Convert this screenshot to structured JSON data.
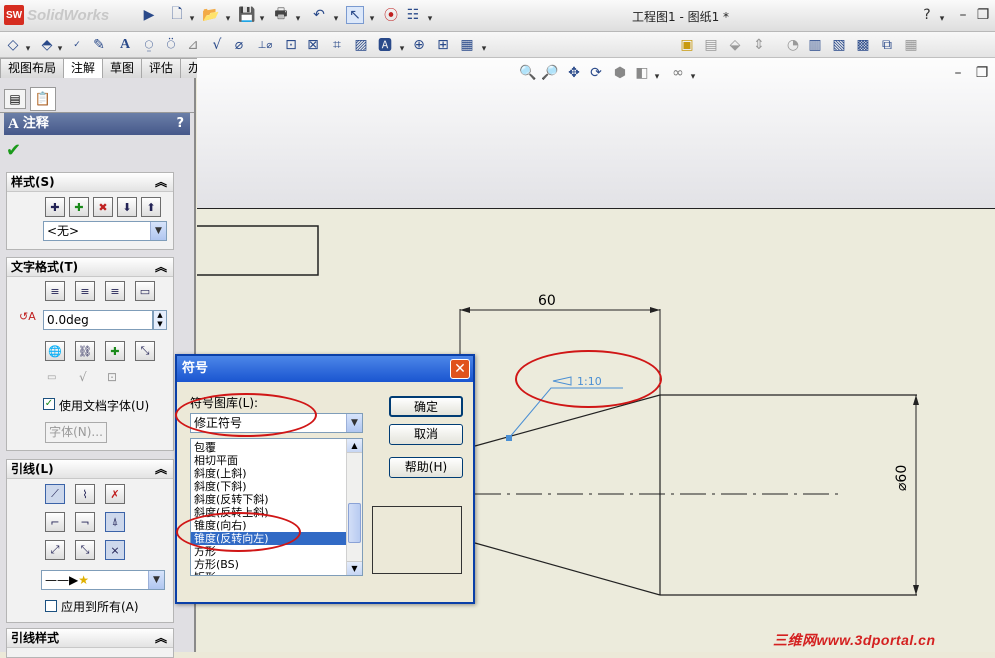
{
  "app": {
    "logo": "SolidWorks",
    "logo_mark": "SW",
    "window_title": "工程图1 - 图纸1 *",
    "help_icon": "?"
  },
  "tabs": [
    {
      "label": "视图布局"
    },
    {
      "label": "注解"
    },
    {
      "label": "草图"
    },
    {
      "label": "评估"
    },
    {
      "label": "办公室产品"
    }
  ],
  "panel": {
    "header_title": "注释",
    "header_help": "?",
    "style_section": {
      "title": "样式(S)",
      "combo_value": "<无>"
    },
    "text_format_section": {
      "title": "文字格式(T)",
      "angle_value": "0.0deg",
      "use_doc_font_label": "使用文档字体(U)",
      "font_button": "字体(N)..."
    },
    "leader_section": {
      "title": "引线(L)",
      "apply_all_label": "应用到所有(A)"
    },
    "leader_style_section": {
      "title": "引线样式"
    }
  },
  "drawing": {
    "dim_top": "60",
    "dim_right": "⌀60",
    "taper_label": "1:10"
  },
  "dialog": {
    "title": "符号",
    "library_label": "符号图库(L):",
    "library_value": "修正符号",
    "ok": "确定",
    "cancel": "取消",
    "help": "帮助(H)",
    "items": [
      "包覆",
      "相切平面",
      "斜度(上斜)",
      "斜度(下斜)",
      "斜度(反转下斜)",
      "斜度(反转上斜)",
      "锥度(向右)",
      "锥度(反转向左)",
      "方形",
      "方形(BS)",
      "矩形"
    ],
    "selected_index": 7
  },
  "watermark": "三维网www.3dportal.cn",
  "colors": {
    "annotation_red": "#d01616",
    "selection_blue": "#316ac5",
    "dim_blue": "#4a8fd4"
  }
}
